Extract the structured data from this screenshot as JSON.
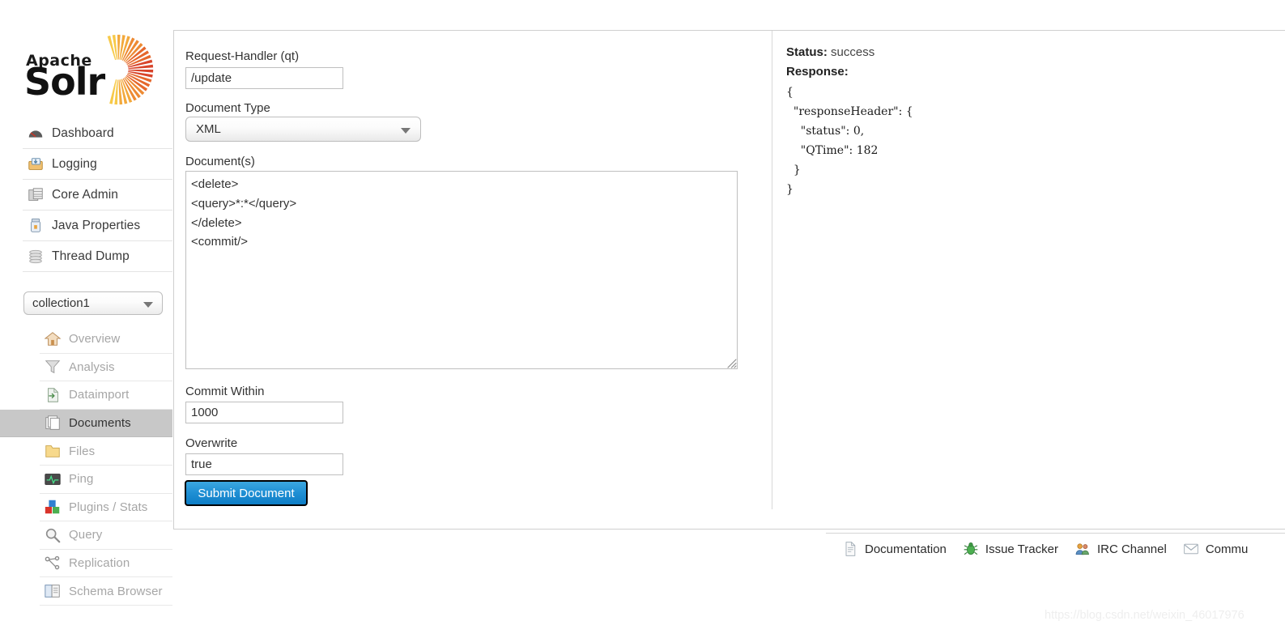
{
  "brand": {
    "apache": "Apache",
    "solr": "Solr",
    "logo_icon": "solr-sunburst-logo"
  },
  "sidebar": {
    "main_nav": [
      {
        "label": "Dashboard",
        "icon": "dashboard-gauge-icon"
      },
      {
        "label": "Logging",
        "icon": "logging-tray-icon"
      },
      {
        "label": "Core Admin",
        "icon": "core-admin-database-icon"
      },
      {
        "label": "Java Properties",
        "icon": "java-properties-jar-icon"
      },
      {
        "label": "Thread Dump",
        "icon": "thread-dump-stack-icon"
      }
    ],
    "collection_select": {
      "value": "collection1",
      "caret_icon": "chevron-down-icon"
    },
    "core_nav": [
      {
        "label": "Overview",
        "icon": "overview-home-icon",
        "active": false
      },
      {
        "label": "Analysis",
        "icon": "analysis-funnel-icon",
        "active": false
      },
      {
        "label": "Dataimport",
        "icon": "dataimport-file-icon",
        "active": false
      },
      {
        "label": "Documents",
        "icon": "documents-pages-icon",
        "active": true
      },
      {
        "label": "Files",
        "icon": "files-folder-icon",
        "active": false
      },
      {
        "label": "Ping",
        "icon": "ping-monitor-icon",
        "active": false
      },
      {
        "label": "Plugins / Stats",
        "icon": "plugins-blocks-icon",
        "active": false
      },
      {
        "label": "Query",
        "icon": "query-magnifier-icon",
        "active": false
      },
      {
        "label": "Replication",
        "icon": "replication-nodes-icon",
        "active": false
      },
      {
        "label": "Schema Browser",
        "icon": "schema-book-icon",
        "active": false
      }
    ]
  },
  "form": {
    "request_handler_label": "Request-Handler (qt)",
    "request_handler_value": "/update",
    "document_type_label": "Document Type",
    "document_type_value": "XML",
    "documents_label": "Document(s)",
    "documents_value": "<delete>\n<query>*:*</query>\n</delete>\n<commit/>",
    "commit_within_label": "Commit Within",
    "commit_within_value": "1000",
    "overwrite_label": "Overwrite",
    "overwrite_value": "true",
    "submit_label": "Submit Document"
  },
  "response": {
    "status_label": "Status:",
    "status_value": "success",
    "response_label": "Response:",
    "json": "{\n  \"responseHeader\": {\n    \"status\": 0,\n    \"QTime\": 182\n  }\n}"
  },
  "footer": {
    "links": [
      {
        "label": "Documentation",
        "icon": "document-page-icon"
      },
      {
        "label": "Issue Tracker",
        "icon": "bug-icon"
      },
      {
        "label": "IRC Channel",
        "icon": "people-group-icon"
      },
      {
        "label": "Commu",
        "icon": "envelope-icon"
      }
    ]
  },
  "watermark": "https://blog.csdn.net/weixin_46017976",
  "colors": {
    "accent_blue": "#1f8fd4",
    "active_row": "#c8c8c8",
    "logo_orange": "#e8762c",
    "logo_red": "#d8442a",
    "logo_yellow": "#f5b731"
  }
}
